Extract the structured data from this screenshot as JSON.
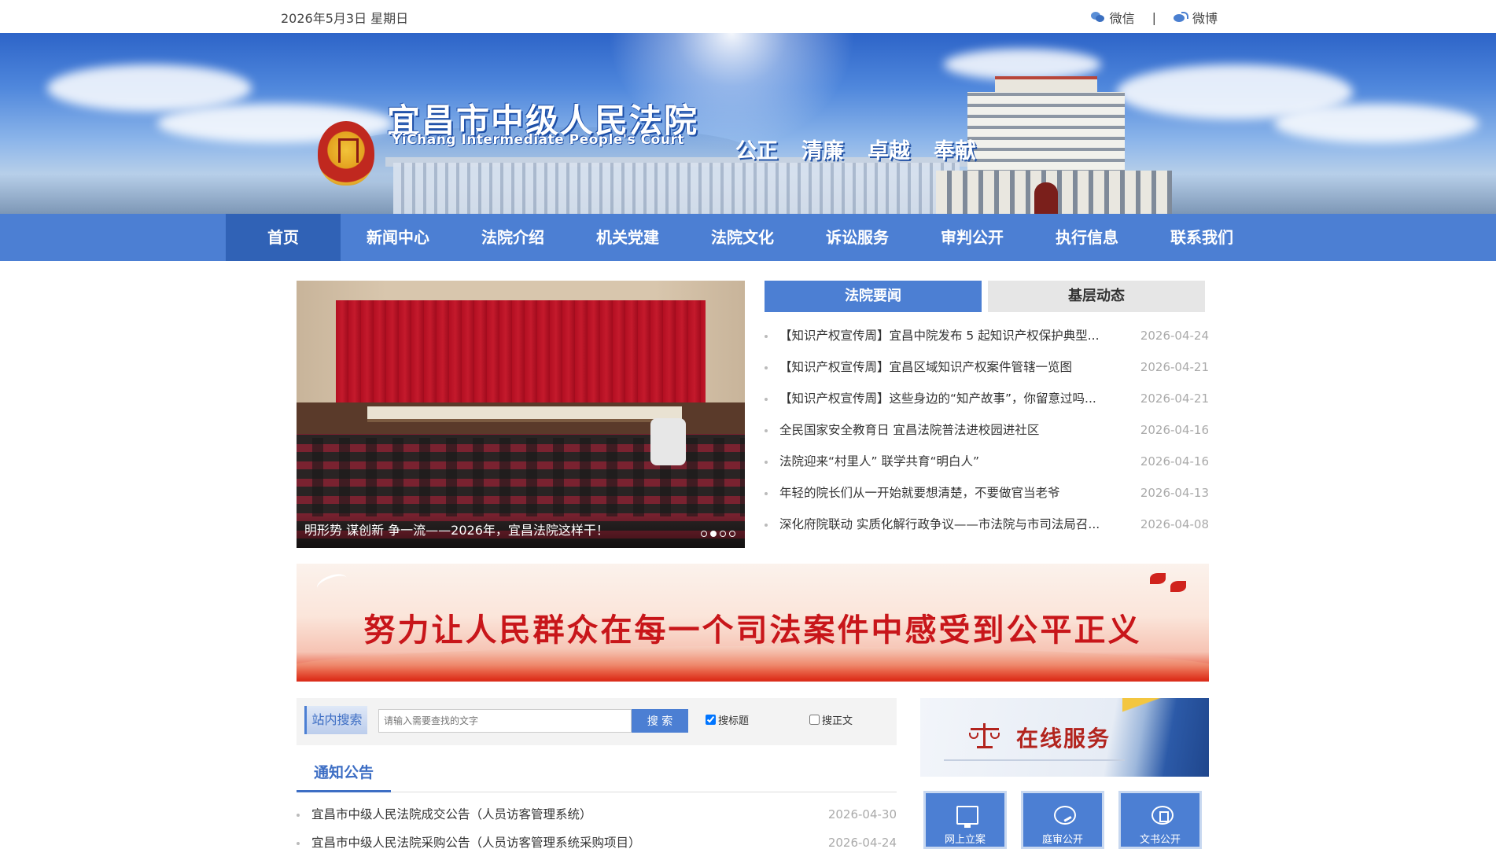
{
  "topbar": {
    "date": "2026年5月3日 星期日",
    "wechat": "微信",
    "separator": "|",
    "weibo": "微博"
  },
  "header": {
    "court_name": "宜昌市中级人民法院",
    "court_name_en": "YiChang Intermediate People's Court",
    "motto": [
      "公正",
      "清廉",
      "卓越",
      "奉献"
    ]
  },
  "nav": {
    "items": [
      "首页",
      "新闻中心",
      "法院介绍",
      "机关党建",
      "法院文化",
      "诉讼服务",
      "审判公开",
      "执行信息",
      "联系我们"
    ],
    "active": "首页"
  },
  "carousel": {
    "caption": "明形势 谋创新 争一流——2026年，宜昌法院这样干！",
    "slide_count": 4,
    "active_slide": 2
  },
  "news": {
    "tabs": [
      "法院要闻",
      "基层动态"
    ],
    "active_tab": "法院要闻",
    "items": [
      {
        "title": "【知识产权宣传周】宜昌中院发布 5 起知识产权保护典型...",
        "date": "2026-04-24"
      },
      {
        "title": "【知识产权宣传周】宜昌区域知识产权案件管辖一览图",
        "date": "2026-04-21"
      },
      {
        "title": "【知识产权宣传周】这些身边的“知产故事”，你留意过吗...",
        "date": "2026-04-21"
      },
      {
        "title": "全民国家安全教育日 宜昌法院普法进校园进社区",
        "date": "2026-04-16"
      },
      {
        "title": "法院迎来“村里人” 联学共育“明白人”",
        "date": "2026-04-16"
      },
      {
        "title": "年轻的院长们从一开始就要想清楚，不要做官当老爷",
        "date": "2026-04-13"
      },
      {
        "title": "深化府院联动 实质化解行政争议——市法院与市司法局召...",
        "date": "2026-04-08"
      }
    ]
  },
  "slogan": {
    "text": "努力让人民群众在每一个司法案件中感受到公平正义"
  },
  "search": {
    "label": "站内搜索",
    "placeholder": "请输入需要查找的文字",
    "button": "搜 索",
    "opt_title": "搜标题",
    "opt_title_checked": true,
    "opt_body": "搜正文",
    "opt_body_checked": false
  },
  "notices": {
    "title": "通知公告",
    "items": [
      {
        "title": "宜昌市中级人民法院成交公告（人员访客管理系统）",
        "date": "2026-04-30"
      },
      {
        "title": "宜昌市中级人民法院采购公告（人员访客管理系统采购项目）",
        "date": "2026-04-24"
      }
    ]
  },
  "online_service": {
    "title": "在线服务",
    "items": [
      {
        "label": "网上立案",
        "icon": "monitor-icon"
      },
      {
        "label": "庭审公开",
        "icon": "gavel-icon"
      },
      {
        "label": "文书公开",
        "icon": "document-icon"
      }
    ]
  },
  "colors": {
    "nav_bg": "#4c7fd3",
    "nav_active": "#3062b6",
    "slogan_red": "#c8161a",
    "date_gray": "#aaaaaa"
  }
}
